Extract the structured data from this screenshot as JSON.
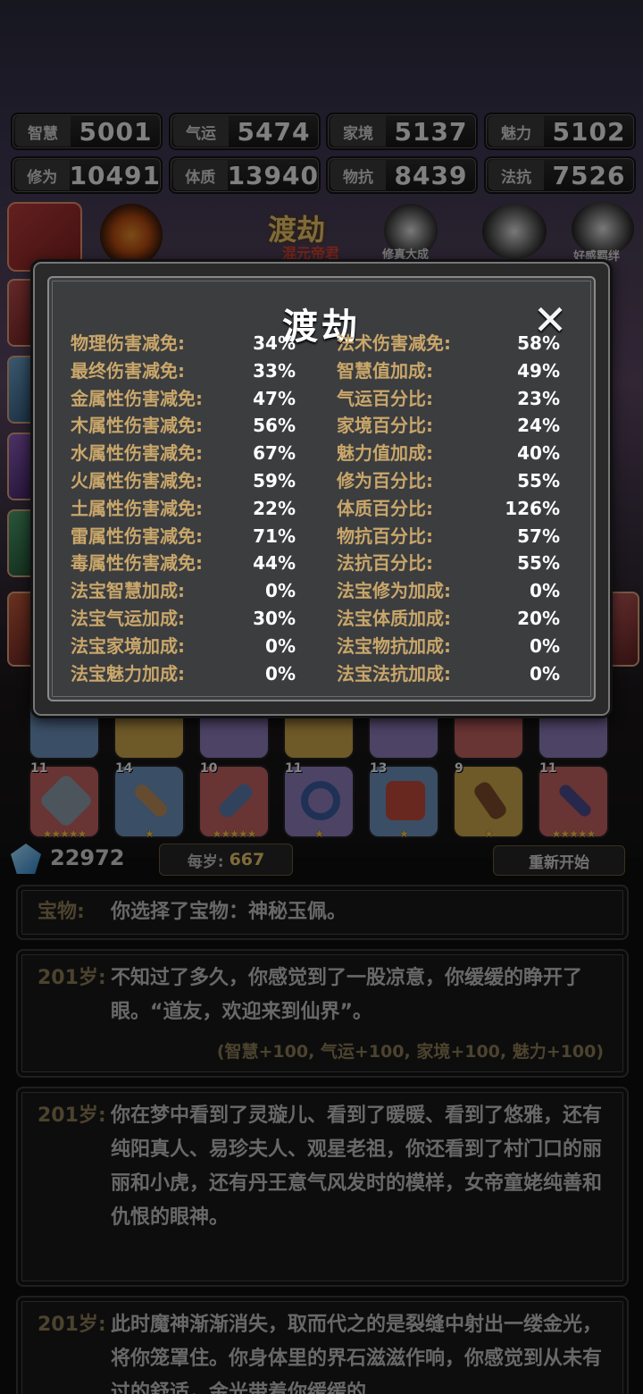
{
  "stats": [
    {
      "label": "智慧",
      "value": "5001"
    },
    {
      "label": "气运",
      "value": "5474"
    },
    {
      "label": "家境",
      "value": "5137"
    },
    {
      "label": "魅力",
      "value": "5102"
    },
    {
      "label": "修为",
      "value": "10491"
    },
    {
      "label": "体质",
      "value": "13940"
    },
    {
      "label": "物抗",
      "value": "8439"
    },
    {
      "label": "法抗",
      "value": "7526"
    }
  ],
  "header": {
    "realm_title": "渡劫",
    "realm_sub": "混元帝君",
    "icon_label_left": "修真大成",
    "icon_label_right": "好感羁绊"
  },
  "modal": {
    "title": "渡劫",
    "close_glyph": "✕",
    "left_attrs": [
      {
        "name": "物理伤害减免:",
        "value": "34%"
      },
      {
        "name": "最终伤害减免:",
        "value": "33%"
      },
      {
        "name": "金属性伤害减免:",
        "value": "47%"
      },
      {
        "name": "木属性伤害减免:",
        "value": "56%"
      },
      {
        "name": "水属性伤害减免:",
        "value": "67%"
      },
      {
        "name": "火属性伤害减免:",
        "value": "59%"
      },
      {
        "name": "土属性伤害减免:",
        "value": "22%"
      },
      {
        "name": "雷属性伤害减免:",
        "value": "71%"
      },
      {
        "name": "毒属性伤害减免:",
        "value": "44%"
      },
      {
        "name": "法宝智慧加成:",
        "value": "0%"
      },
      {
        "name": "法宝气运加成:",
        "value": "30%"
      },
      {
        "name": "法宝家境加成:",
        "value": "0%"
      },
      {
        "name": "法宝魅力加成:",
        "value": "0%"
      }
    ],
    "right_attrs": [
      {
        "name": "法术伤害减免:",
        "value": "58%"
      },
      {
        "name": "智慧值加成:",
        "value": "49%"
      },
      {
        "name": "气运百分比:",
        "value": "23%"
      },
      {
        "name": "家境百分比:",
        "value": "24%"
      },
      {
        "name": "魅力值加成:",
        "value": "40%"
      },
      {
        "name": "修为百分比:",
        "value": "55%"
      },
      {
        "name": "体质百分比:",
        "value": "126%"
      },
      {
        "name": "物抗百分比:",
        "value": "57%"
      },
      {
        "name": "法抗百分比:",
        "value": "55%"
      },
      {
        "name": "法宝修为加成:",
        "value": "0%"
      },
      {
        "name": "法宝体质加成:",
        "value": "20%"
      },
      {
        "name": "法宝物抗加成:",
        "value": "0%"
      },
      {
        "name": "法宝法抗加成:",
        "value": "0%"
      }
    ]
  },
  "items": [
    {
      "level": "11",
      "stars": "★★★★★",
      "color": "#c06060"
    },
    {
      "level": "14",
      "stars": "★",
      "color": "#6a8fb8"
    },
    {
      "level": "10",
      "stars": "★★★★★",
      "color": "#c06060"
    },
    {
      "level": "11",
      "stars": "★",
      "color": "#8a7ab8"
    },
    {
      "level": "13",
      "stars": "★",
      "color": "#6a8fb8"
    },
    {
      "level": "9",
      "stars": "★",
      "color": "#c9a24a"
    },
    {
      "level": "11",
      "stars": "★★★★★",
      "color": "#c06060"
    }
  ],
  "currency": {
    "value": "22972"
  },
  "per_year": {
    "label": "每岁:",
    "value": "667"
  },
  "restart_label": "重新开始",
  "logs": [
    {
      "age": "宝物:",
      "text": "你选择了宝物：神秘玉佩。"
    },
    {
      "age": "201岁:",
      "text": "不知过了多久，你感觉到了一股凉意，你缓缓的睁开了眼。“道友，欢迎来到仙界”。",
      "bonus": "(智慧+100, 气运+100, 家境+100, 魅力+100)"
    },
    {
      "age": "201岁:",
      "text": "你在梦中看到了灵璇儿、看到了暖暖、看到了悠雅，还有纯阳真人、易珍夫人、观星老祖，你还看到了村门口的丽丽和小虎，还有丹王意气风发时的模样，女帝童姥纯善和仇恨的眼神。"
    },
    {
      "age": "201岁:",
      "text": "此时魔神渐渐消失，取而代之的是裂缝中射出一缕金光，将你笼罩住。你身体里的界石滋滋作响，你感觉到从未有过的舒适，金光带着你缓缓的"
    }
  ]
}
